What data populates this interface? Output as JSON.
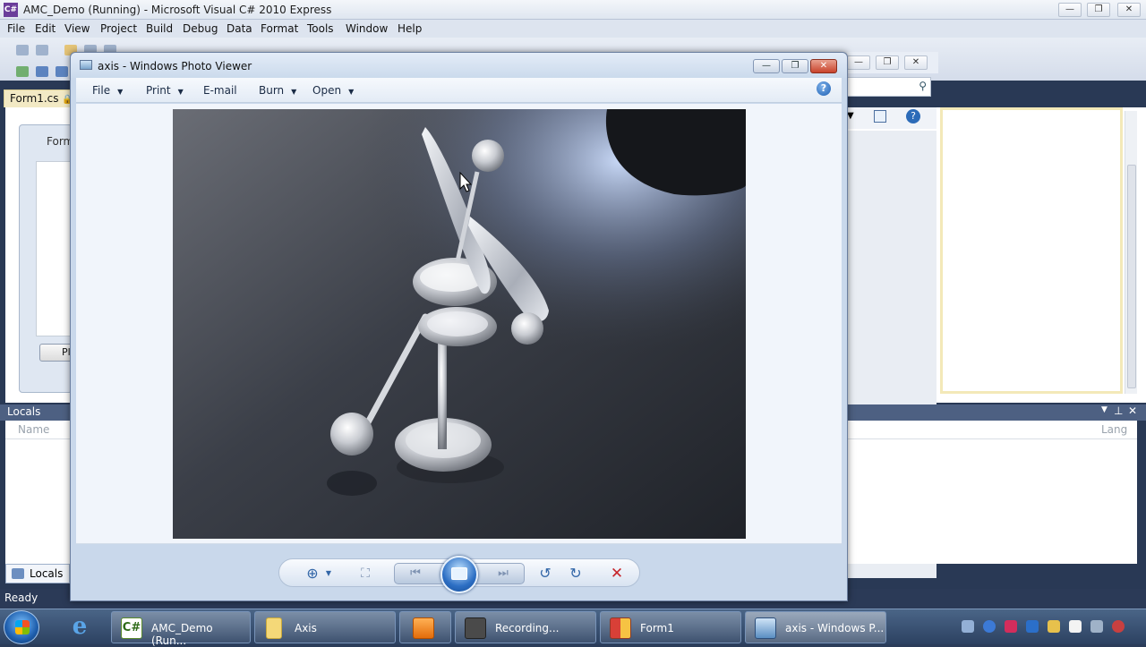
{
  "vs": {
    "title": "AMC_Demo (Running) - Microsoft Visual C# 2010 Express",
    "menu": [
      "File",
      "Edit",
      "View",
      "Project",
      "Build",
      "Debug",
      "Data",
      "Format",
      "Tools",
      "Window",
      "Help"
    ],
    "doc_tab": "Form1.cs",
    "form_title": "Form",
    "form_button": "Pl",
    "locals_title": "Locals",
    "locals_col_name": "Name",
    "locals_col_lang": "Lang",
    "locals_tab": "Locals",
    "status": "Ready"
  },
  "viewer": {
    "title": "axis - Windows Photo Viewer",
    "commands": [
      "File",
      "Print",
      "E-mail",
      "Burn",
      "Open"
    ],
    "help": "?"
  },
  "taskbar": {
    "items": [
      {
        "label": "AMC_Demo (Run...",
        "icon": "csharp-icon"
      },
      {
        "label": "Axis",
        "icon": "folder-icon"
      },
      {
        "label": "",
        "icon": "media-player-icon"
      },
      {
        "label": "Recording...",
        "icon": "recorder-icon"
      },
      {
        "label": "Form1",
        "icon": "form-icon"
      },
      {
        "label": "axis - Windows P...",
        "icon": "photo-viewer-icon"
      }
    ]
  },
  "colors": {
    "vs_dark": "#293955",
    "viewer_chrome": "#c9d8eb",
    "taskbar": "#2c4161",
    "close_red": "#c8432b"
  }
}
